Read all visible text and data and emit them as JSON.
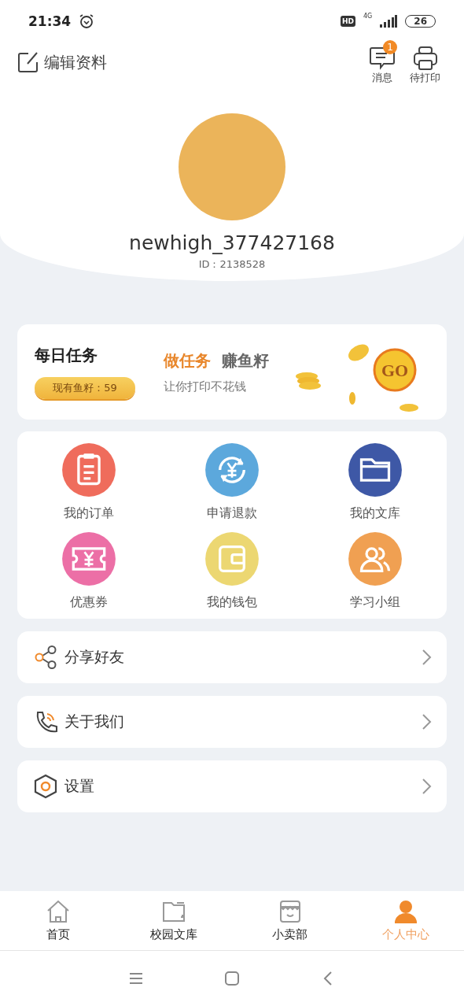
{
  "status_bar": {
    "time": "21:34",
    "hd": "HD",
    "network": "4G",
    "battery": "26"
  },
  "header": {
    "edit_label": "编辑资料",
    "actions": [
      {
        "kind": "message",
        "label": "消息",
        "badge": "1"
      },
      {
        "kind": "printer",
        "label": "待打印"
      }
    ]
  },
  "profile": {
    "username": "newhigh_377427168",
    "id": "ID：2138528"
  },
  "daily_task": {
    "title": "每日任务",
    "balance": "现有鱼籽：59",
    "headline_accent": "做任务",
    "headline": "赚鱼籽",
    "subtitle": "让你打印不花钱",
    "go": "GO"
  },
  "services": [
    {
      "kind": "order",
      "label": "我的订单",
      "color": "#ef6c5c"
    },
    {
      "kind": "refund",
      "label": "申请退款",
      "color": "#5ca8dc"
    },
    {
      "kind": "folder",
      "label": "我的文库",
      "color": "#3e58a6"
    },
    {
      "kind": "coupon",
      "label": "优惠券",
      "color": "#ec6fa6"
    },
    {
      "kind": "wallet",
      "label": "我的钱包",
      "color": "#ecd772"
    },
    {
      "kind": "group",
      "label": "学习小组",
      "color": "#f0a052"
    }
  ],
  "menu": [
    {
      "kind": "share",
      "label": "分享好友"
    },
    {
      "kind": "phone",
      "label": "关于我们"
    },
    {
      "kind": "settings",
      "label": "设置"
    }
  ],
  "tab_bar": [
    {
      "kind": "home",
      "label": "首页",
      "selected": false
    },
    {
      "kind": "folder",
      "label": "校园文库",
      "selected": false
    },
    {
      "kind": "shop",
      "label": "小卖部",
      "selected": false
    },
    {
      "kind": "person",
      "label": "个人中心",
      "selected": true
    }
  ]
}
